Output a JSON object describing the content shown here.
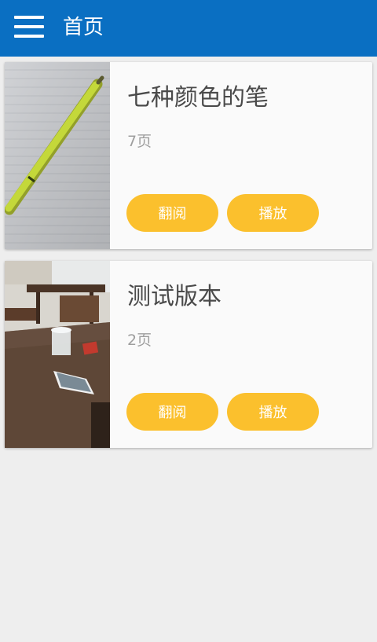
{
  "header": {
    "title": "首页",
    "menu_icon": "hamburger-menu-icon"
  },
  "colors": {
    "appbar": "#0a6fc2",
    "button": "#fbc02d",
    "background": "#eeeeee"
  },
  "books": [
    {
      "title": "七种颜色的笔",
      "pages": "7页",
      "read_label": "翻阅",
      "play_label": "播放",
      "thumbnail": "photo of a yellow-green pen on lined paper"
    },
    {
      "title": "测试版本",
      "pages": "2页",
      "read_label": "翻阅",
      "play_label": "播放",
      "thumbnail": "photo of a wooden table with a phone and a cup"
    }
  ]
}
